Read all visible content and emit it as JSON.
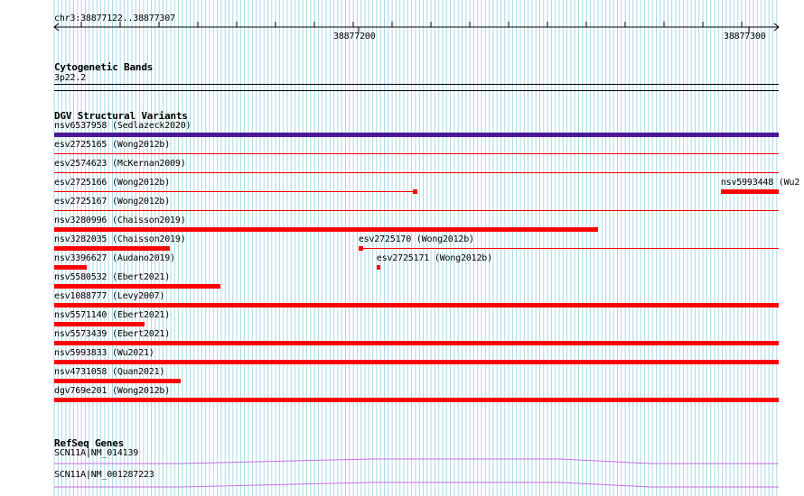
{
  "colors": {
    "grid": "#a9d9e3",
    "variant": "#ff0000",
    "variant_strong": "#4a1796",
    "gene": "#c86ee0",
    "ruler": "#000000"
  },
  "ruler": {
    "range_label": "chr3:38877122..38877307",
    "ticks": [
      "38877200",
      "38877300"
    ]
  },
  "cyto": {
    "title": "Cytogenetic Bands",
    "band": "3p22.2"
  },
  "dgv": {
    "title": "DGV Structural Variants",
    "features": [
      {
        "label": "nsv6537958 (Sedlazeck2020)",
        "start": 0.0,
        "end": 1.0,
        "type": "strong"
      },
      {
        "label": "esv2725165 (Wong2012b)",
        "start": 0.0,
        "end": 1.0,
        "type": "line"
      },
      {
        "label": "esv2574623 (McKernan2009)",
        "start": 0.0,
        "end": 1.0,
        "type": "line"
      },
      {
        "label": "esv2725166 (Wong2012b)",
        "start": 0.0,
        "end": 0.5,
        "type": "line"
      },
      {
        "label": "nsv5993448 (Wu2",
        "start": 0.92,
        "end": 1.0,
        "type": "bar"
      },
      {
        "label": "esv2725167 (Wong2012b)",
        "start": 0.0,
        "end": 1.0,
        "type": "line"
      },
      {
        "label": "nsv3280996 (Chaisson2019)",
        "start": 0.0,
        "end": 0.75,
        "type": "bar"
      },
      {
        "label": "nsv3282035 (Chaisson2019)",
        "start": 0.0,
        "end": 0.16,
        "type": "bar"
      },
      {
        "label": "esv2725170 (Wong2012b)",
        "start": 0.42,
        "end": 1.0,
        "type": "line"
      },
      {
        "label": "nsv3396627 (Audano2019)",
        "start": 0.0,
        "end": 0.045,
        "type": "bar"
      },
      {
        "label": "esv2725171 (Wong2012b)",
        "start": 0.445,
        "end": 0.45,
        "type": "bar"
      },
      {
        "label": "nsv5580532 (Ebert2021)",
        "start": 0.0,
        "end": 0.23,
        "type": "bar"
      },
      {
        "label": "esv1088777 (Levy2007)",
        "start": 0.0,
        "end": 1.0,
        "type": "bar"
      },
      {
        "label": "nsv5571140 (Ebert2021)",
        "start": 0.0,
        "end": 0.125,
        "type": "bar"
      },
      {
        "label": "nsv5573439 (Ebert2021)",
        "start": 0.0,
        "end": 1.0,
        "type": "bar"
      },
      {
        "label": "nsv5993833 (Wu2021)",
        "start": 0.0,
        "end": 1.0,
        "type": "bar"
      },
      {
        "label": "nsv4731058 (Quan2021)",
        "start": 0.0,
        "end": 0.175,
        "type": "bar"
      },
      {
        "label": "dgv769e201 (Wong2012b)",
        "start": 0.0,
        "end": 1.0,
        "type": "bar"
      }
    ]
  },
  "refseq": {
    "title": "RefSeq Genes",
    "genes": [
      {
        "label": "SCN11A|NM_014139"
      },
      {
        "label": "SCN11A|NM_001287223"
      }
    ]
  }
}
